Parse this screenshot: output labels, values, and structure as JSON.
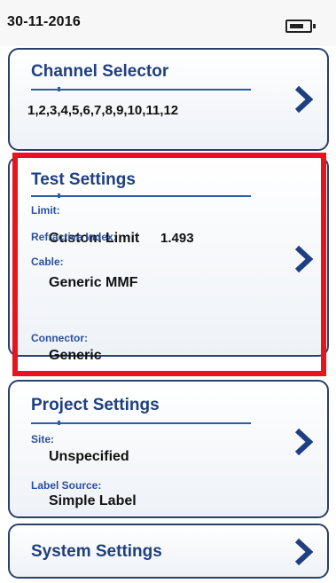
{
  "status_bar": {
    "date": "30-11-2016",
    "battery_icon": "battery-icon"
  },
  "cards": {
    "channel_selector": {
      "title": "Channel Selector",
      "channels": "1,2,3,4,5,6,7,8,9,10,11,12"
    },
    "test_settings": {
      "title": "Test Settings",
      "limit_label": "Limit:",
      "limit_value": "Custom Limit",
      "cable_label": "Cable:",
      "cable_value": "Generic MMF",
      "refractive_label": "Refractive Index:",
      "refractive_value": "1.493",
      "connector_label": "Connector:",
      "connector_value": "Generic"
    },
    "project_settings": {
      "title": "Project Settings",
      "site_label": "Site:",
      "site_value": "Unspecified",
      "label_source_label": "Label Source:",
      "label_source_value": "Simple Label"
    },
    "system_settings": {
      "title": "System Settings"
    }
  },
  "icons": {
    "chevron": "chevron-right-icon"
  },
  "colors": {
    "accent": "#1f3f80",
    "highlight": "#e8141b",
    "label": "#2b4fa0"
  }
}
